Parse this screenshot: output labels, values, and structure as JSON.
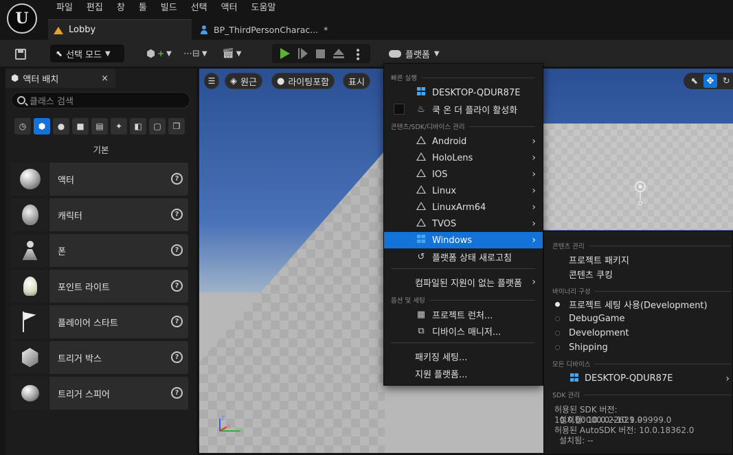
{
  "menubar": {
    "items": [
      "파일",
      "편집",
      "창",
      "툴",
      "빌드",
      "선택",
      "액터",
      "도움말"
    ]
  },
  "tabs": [
    {
      "label": "Lobby"
    },
    {
      "label": "BP_ThirdPersonCharac...",
      "dirty_marker": "*"
    }
  ],
  "toolbar": {
    "mode_label": "선택 모드",
    "platforms_label": "플랫폼"
  },
  "place_actors": {
    "tab_label": "액터 배치",
    "close_glyph": "×",
    "search_placeholder": "클래스 검색",
    "category_label": "기본",
    "items": [
      {
        "label": "액터"
      },
      {
        "label": "캐릭터"
      },
      {
        "label": "폰"
      },
      {
        "label": "포인트 라이트"
      },
      {
        "label": "플레이어 스타트"
      },
      {
        "label": "트리거 박스"
      },
      {
        "label": "트리거 스피어"
      }
    ]
  },
  "viewport": {
    "perspective_label": "원근",
    "lighting_label": "라이팅포함",
    "show_label": "표시"
  },
  "platform_menu": {
    "quick_launch_header": "빠른 실행",
    "device_name": "DESKTOP-QDUR87E",
    "cook_on_fly_label": "쿡 온 더 플라이 활성화",
    "content_sdk_header": "콘텐츠/SDK/디바이스 관리",
    "platforms": [
      "Android",
      "HoloLens",
      "IOS",
      "Linux",
      "LinuxArm64",
      "TVOS",
      "Windows"
    ],
    "refresh_label": "플랫폼 상태 새로고침",
    "unsupported_label": "컴파일된 지원이 없는 플랫폼",
    "options_header": "옵션 및 세팅",
    "project_launcher_label": "프로젝트 런처...",
    "device_manager_label": "디바이스 매니저...",
    "packaging_settings_label": "패키징 세팅...",
    "supported_platforms_label": "지원 플랫폼..."
  },
  "windows_submenu": {
    "content_header": "콘텐츠 관리",
    "package_project_label": "프로젝트 패키지",
    "cook_content_label": "콘텐츠 쿠킹",
    "binary_config_header": "바이너리 구성",
    "configs": [
      {
        "label": "프로젝트 세팅 사용(Development)",
        "selected": true
      },
      {
        "label": "DebugGame",
        "selected": false
      },
      {
        "label": "Development",
        "selected": false
      },
      {
        "label": "Shipping",
        "selected": false
      }
    ],
    "all_devices_header": "모든 디바이스",
    "device_name": "DESKTOP-QDUR87E",
    "sdk_header": "SDK 관리",
    "sdk_allowed": "허용된 SDK 버전: 10.0.00000.0~10.9.99999.0",
    "sdk_installed": "설치됨: 10.0.22621.0",
    "autosdk_allowed": "허용된 AutoSDK 버전: 10.0.18362.0",
    "autosdk_installed": "설치됨: --"
  },
  "colors": {
    "accent": "#1473d8",
    "play_green": "#5fb22f",
    "map_tab_icon": "#f0a020"
  }
}
